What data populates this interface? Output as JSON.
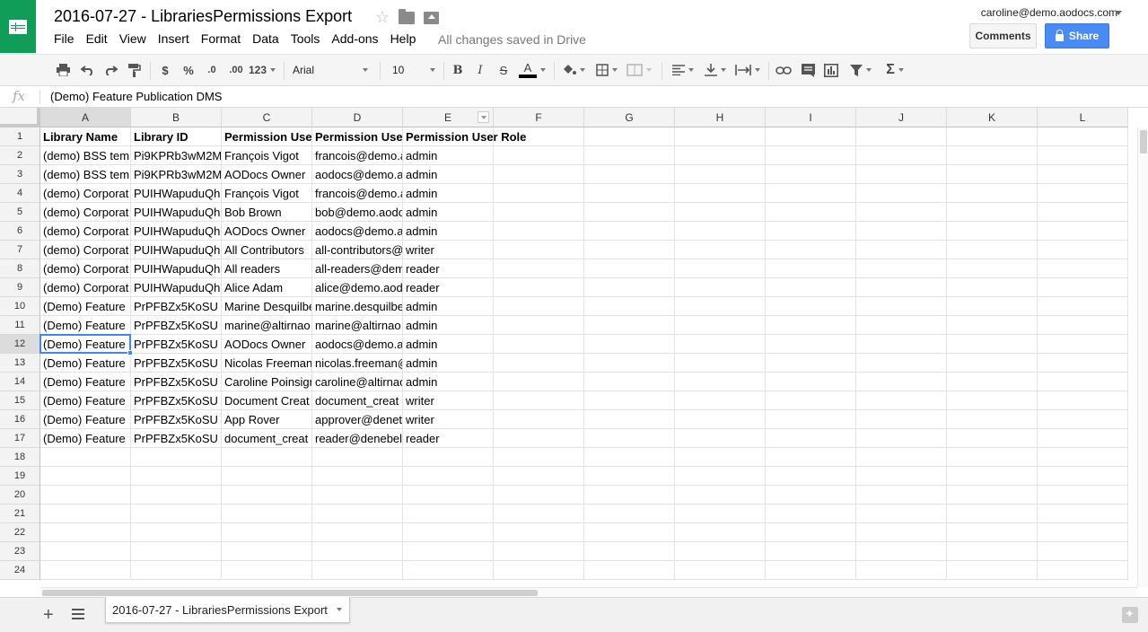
{
  "header": {
    "doc_title": "2016-07-27 - LibrariesPermissions Export",
    "account": "caroline@demo.aodocs.com",
    "saved_status": "All changes saved in Drive",
    "comments_label": "Comments",
    "share_label": "Share",
    "menu": [
      "File",
      "Edit",
      "View",
      "Insert",
      "Format",
      "Data",
      "Tools",
      "Add-ons",
      "Help"
    ]
  },
  "toolbar": {
    "currency": "$",
    "percent": "%",
    "dec_less": ".0",
    "dec_more": ".00",
    "more_formats": "123",
    "font": "Arial",
    "font_size": "10",
    "bold": "B",
    "italic": "I",
    "strike": "S",
    "text_color": "A",
    "text_color_value": "#000000"
  },
  "formula_bar": {
    "fx": "fx",
    "value": "(Demo) Feature Publication DMS"
  },
  "grid": {
    "columns": [
      "A",
      "B",
      "C",
      "D",
      "E",
      "F",
      "G",
      "H",
      "I",
      "J",
      "K",
      "L"
    ],
    "row_numbers": [
      "1",
      "2",
      "3",
      "4",
      "5",
      "6",
      "7",
      "8",
      "9",
      "10",
      "11",
      "12",
      "13",
      "14",
      "15",
      "16",
      "17",
      "18",
      "19",
      "20",
      "21",
      "22",
      "23",
      "24"
    ],
    "selected_cell": "A12",
    "header_row": [
      "Library Name",
      "Library ID",
      "Permission Use",
      "Permission Use",
      "Permission User Role"
    ],
    "rows": [
      [
        "(demo) BSS tem",
        "Pi9KPRb3wM2M",
        "François Vigot",
        "francois@demo.a",
        "admin"
      ],
      [
        "(demo) BSS tem",
        "Pi9KPRb3wM2M",
        "AODocs Owner",
        "aodocs@demo.a",
        "admin"
      ],
      [
        "(demo) Corporat",
        "PUIHWapuduQh",
        "François Vigot",
        "francois@demo.a",
        "admin"
      ],
      [
        "(demo) Corporat",
        "PUIHWapuduQh",
        "Bob Brown",
        "bob@demo.aodo",
        "admin"
      ],
      [
        "(demo) Corporat",
        "PUIHWapuduQh",
        "AODocs Owner",
        "aodocs@demo.a",
        "admin"
      ],
      [
        "(demo) Corporat",
        "PUIHWapuduQh",
        "All Contributors",
        "all-contributors@",
        "writer"
      ],
      [
        "(demo) Corporat",
        "PUIHWapuduQh",
        "All readers",
        "all-readers@dem",
        "reader"
      ],
      [
        "(demo) Corporat",
        "PUIHWapuduQh",
        "Alice Adam",
        "alice@demo.aod",
        "reader"
      ],
      [
        "(Demo) Feature",
        "PrPFBZx5KoSU",
        "Marine Desquilbe",
        "marine.desquilbe",
        "admin"
      ],
      [
        "(Demo) Feature",
        "PrPFBZx5KoSU",
        "marine@altirnao",
        "marine@altirnao",
        "admin"
      ],
      [
        "(Demo) Feature",
        "PrPFBZx5KoSU",
        "AODocs Owner",
        "aodocs@demo.a",
        "admin"
      ],
      [
        "(Demo) Feature",
        "PrPFBZx5KoSU",
        "Nicolas Freeman",
        "nicolas.freeman@",
        "admin"
      ],
      [
        "(Demo) Feature",
        "PrPFBZx5KoSU",
        "Caroline Poinsign",
        "caroline@altirnao",
        "admin"
      ],
      [
        "(Demo) Feature",
        "PrPFBZx5KoSU",
        "Document Creat",
        "document_creat",
        "writer"
      ],
      [
        "(Demo) Feature",
        "PrPFBZx5KoSU",
        "App Rover",
        "approver@denet",
        "writer"
      ],
      [
        "(Demo) Feature",
        "PrPFBZx5KoSU",
        "document_creat",
        "reader@denebel",
        "reader"
      ]
    ]
  },
  "sheet_tabs": [
    {
      "label": "2016-07-27 - LibrariesPermissions Export",
      "active": true
    }
  ],
  "colors": {
    "brand_green": "#0f9d58",
    "share_blue": "#4a8af4",
    "selection_blue": "#4285f4"
  }
}
